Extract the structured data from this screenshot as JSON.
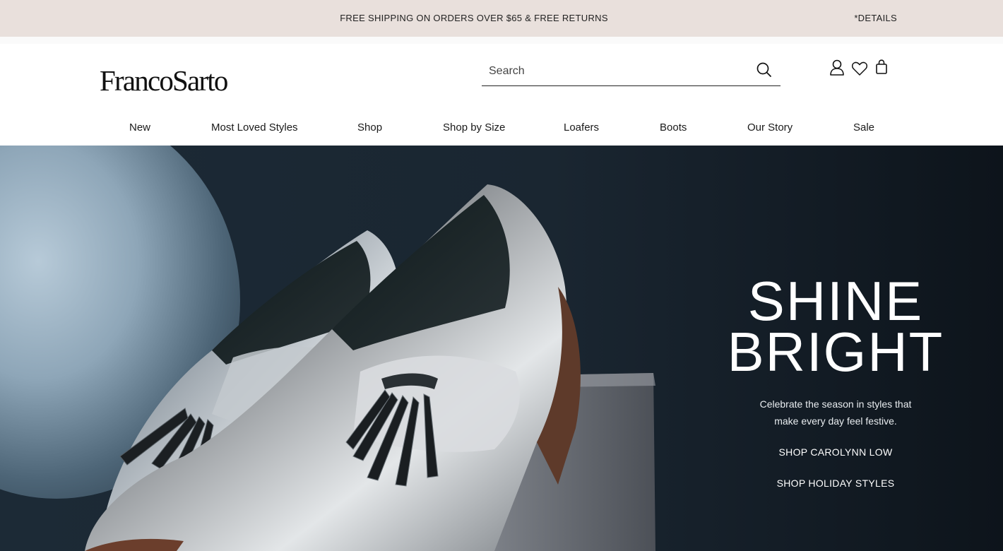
{
  "promo": {
    "message": "FREE SHIPPING ON ORDERS OVER $65 & FREE RETURNS",
    "details_link": "*DETAILS"
  },
  "header": {
    "logo_text": "FrancoSarto",
    "search": {
      "placeholder": "Search",
      "value": ""
    },
    "icons": [
      "search-icon",
      "account-icon",
      "wishlist-heart-icon",
      "shopping-bag-icon"
    ]
  },
  "nav": {
    "items": [
      "New",
      "Most Loved Styles",
      "Shop",
      "Shop by Size",
      "Loafers",
      "Boots",
      "Our Story",
      "Sale"
    ]
  },
  "hero": {
    "title_line1": "SHINE",
    "title_line2": "BRIGHT",
    "subtitle": "Celebrate the season in styles that make every day feel festive.",
    "cta_primary": "SHOP CAROLYNN LOW",
    "cta_secondary": "SHOP HOLIDAY STYLES"
  },
  "colors": {
    "promo_bg": "#e9e0dc",
    "hero_bg": "#1a2631",
    "text_dark": "#1a1a1a",
    "text_light": "#ffffff"
  }
}
